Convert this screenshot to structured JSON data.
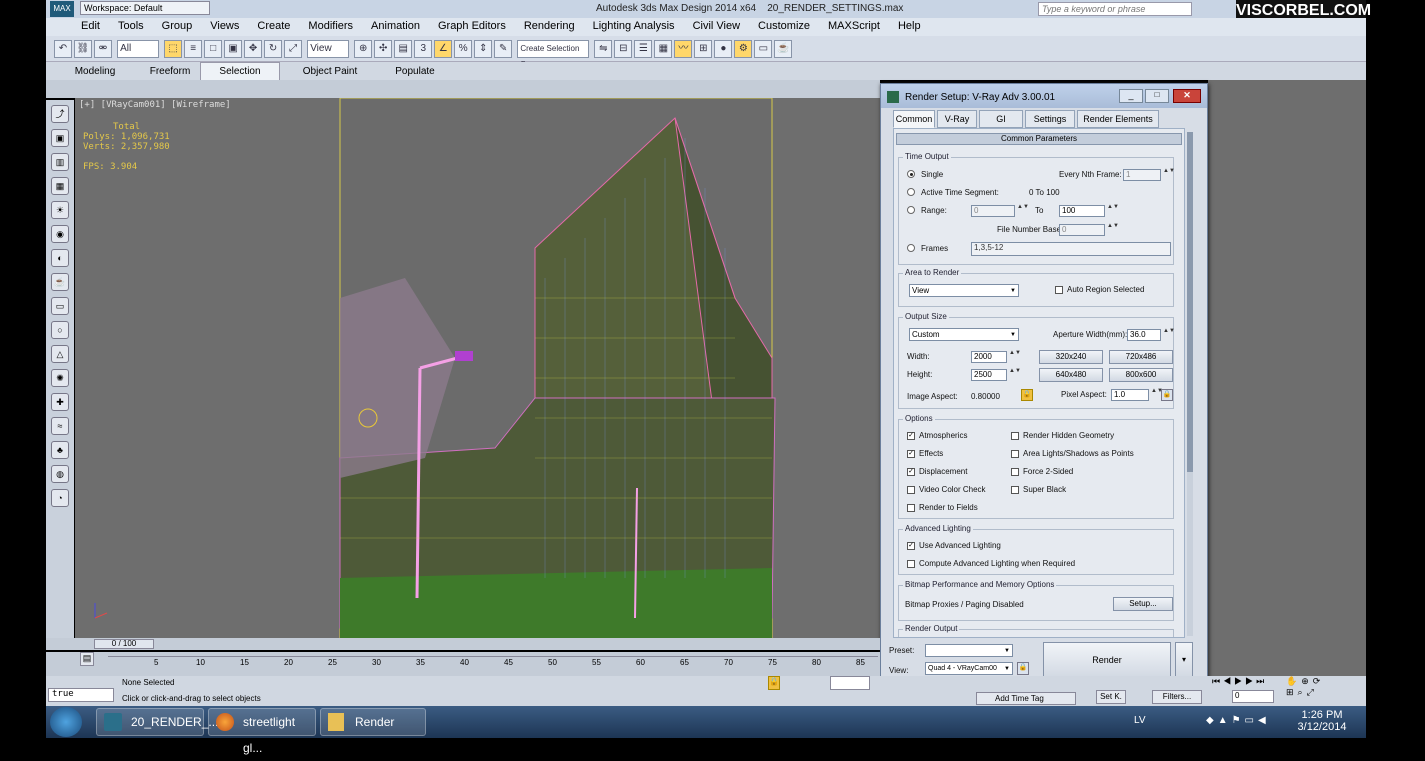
{
  "app": {
    "title": "Autodesk 3ds Max Design 2014 x64",
    "file": "20_RENDER_SETTINGS.max",
    "workspace": "Workspace: Default",
    "search_placeholder": "Type a keyword or phrase",
    "brand": "VISCORBEL.COM"
  },
  "menu": [
    "Edit",
    "Tools",
    "Group",
    "Views",
    "Create",
    "Modifiers",
    "Animation",
    "Graph Editors",
    "Rendering",
    "Lighting Analysis",
    "Civil View",
    "Customize",
    "MAXScript",
    "Help"
  ],
  "toolbar": {
    "filter": "All",
    "view": "View",
    "selection_set": "Create Selection Se"
  },
  "ribbon": [
    "Modeling",
    "Freeform",
    "Selection",
    "Object Paint",
    "Populate"
  ],
  "viewport": {
    "label": "[+] [VRayCam001] [Wireframe]",
    "stats_total": "Total",
    "stats_polys": "Polys: 1,096,731",
    "stats_verts": "Verts: 2,357,980",
    "stats_fps": "FPS:  3.904"
  },
  "dialog": {
    "title": "Render Setup: V-Ray Adv 3.00.01",
    "tabs": [
      "Common",
      "V-Ray",
      "GI",
      "Settings",
      "Render Elements"
    ],
    "rollout": "Common Parameters",
    "time_output": {
      "title": "Time Output",
      "single": "Single",
      "every_nth": "Every Nth Frame:",
      "every_nth_val": "1",
      "active_segment": "Active Time Segment:",
      "active_range": "0 To 100",
      "range": "Range:",
      "range_from": "0",
      "to": "To",
      "range_to": "100",
      "file_number_base": "File Number Base:",
      "file_number_base_val": "0",
      "frames": "Frames",
      "frames_val": "1,3,5-12"
    },
    "area": {
      "title": "Area to Render",
      "value": "View",
      "auto_region": "Auto Region Selected"
    },
    "output_size": {
      "title": "Output Size",
      "preset": "Custom",
      "aperture": "Aperture Width(mm):",
      "aperture_val": "36.0",
      "width": "Width:",
      "width_val": "2000",
      "height": "Height:",
      "height_val": "2500",
      "presets": [
        "320x240",
        "720x486",
        "640x480",
        "800x600"
      ],
      "image_aspect": "Image Aspect:",
      "image_aspect_val": "0.80000",
      "pixel_aspect": "Pixel Aspect:",
      "pixel_aspect_val": "1.0"
    },
    "options": {
      "title": "Options",
      "items": [
        "Atmospherics",
        "Render Hidden Geometry",
        "Effects",
        "Area Lights/Shadows as Points",
        "Displacement",
        "Force 2-Sided",
        "Video Color Check",
        "Super Black",
        "Render to Fields"
      ]
    },
    "advanced": {
      "title": "Advanced Lighting",
      "use": "Use Advanced Lighting",
      "compute": "Compute Advanced Lighting when Required"
    },
    "bitmap": {
      "title": "Bitmap Performance and Memory Options",
      "status": "Bitmap Proxies / Paging Disabled",
      "setup": "Setup..."
    },
    "render_output": "Render Output",
    "preset_label": "Preset:",
    "view_label": "View:",
    "view_value": "Quad 4 - VRayCam00",
    "render_button": "Render"
  },
  "timeline": {
    "frame": "0 / 100",
    "ticks": [
      "5",
      "10",
      "15",
      "20",
      "25",
      "30",
      "35",
      "40",
      "45",
      "50",
      "55",
      "60",
      "65",
      "70",
      "75",
      "80",
      "85"
    ]
  },
  "status": {
    "maxscript": "true",
    "selected": "None Selected",
    "prompt": "Click or click-and-drag to select objects",
    "add_time_tag": "Add Time Tag",
    "set_key": "Set K.",
    "filters": "Filters...",
    "frame_field": "0"
  },
  "taskbar": {
    "items": [
      "20_RENDER_...",
      "streetlight gl...",
      "Render"
    ],
    "lang": "LV",
    "time": "1:26 PM",
    "date": "3/12/2014"
  },
  "colors": {
    "viewport_bg": "#6e6e6e",
    "ui_bg": "#d0d7e1",
    "stats": "#e4c84a",
    "title_accent": "#a9bcd8"
  }
}
